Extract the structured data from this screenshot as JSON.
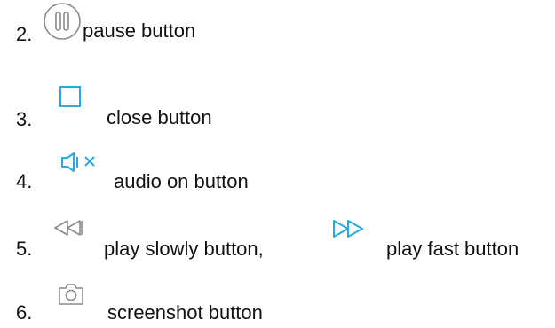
{
  "items": [
    {
      "number": "2.",
      "icon": "pause-circle-icon",
      "label": "pause button"
    },
    {
      "number": "3.",
      "icon": "stop-square-icon",
      "label": "close button"
    },
    {
      "number": "4.",
      "icon": "speaker-muted-icon",
      "label": "audio on button"
    },
    {
      "number": "5.",
      "icons": [
        "rewind-icon",
        "fast-forward-icon"
      ],
      "label": "play slowly button,",
      "label2": "play fast button"
    },
    {
      "number": "6.",
      "icon": "camera-icon",
      "label": "screenshot button"
    }
  ],
  "colors": {
    "text": "#111111",
    "icon_gray": "#8a8a8a",
    "icon_blue": "#29a8df"
  }
}
